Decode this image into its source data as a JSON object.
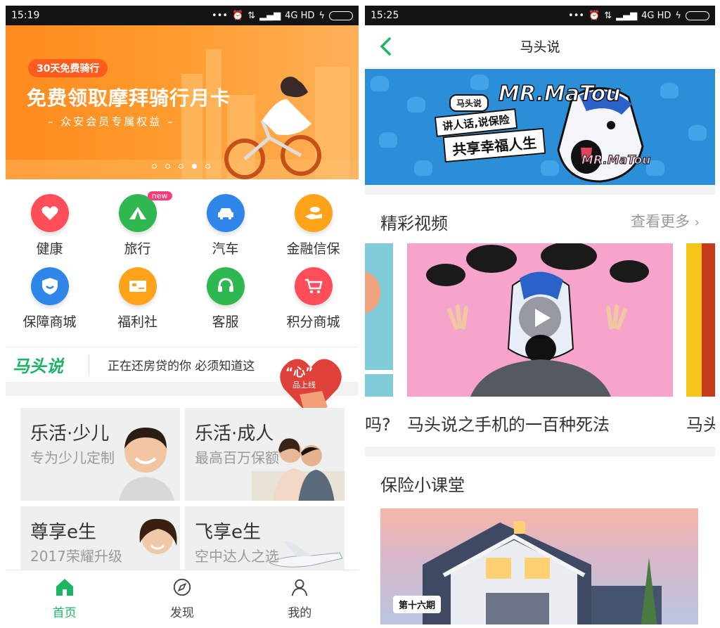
{
  "left": {
    "status": {
      "time": "15:19",
      "network": "4G HD"
    },
    "banner": {
      "badge": "30天免费骑行",
      "title": "免费领取摩拜骑行月卡",
      "subtitle": "– 众安会员专属权益 –",
      "dots_count": 5,
      "active_dot": 4
    },
    "grid": [
      {
        "label": "健康",
        "icon": "heart-icon",
        "color": "#ff4d5a"
      },
      {
        "label": "旅行",
        "icon": "tent-icon",
        "color": "#2fb84f",
        "badge": "new"
      },
      {
        "label": "汽车",
        "icon": "car-icon",
        "color": "#2e86e8"
      },
      {
        "label": "金融信保",
        "icon": "hand-coin-icon",
        "color": "#ffa31a"
      },
      {
        "label": "保障商城",
        "icon": "shield-icon",
        "color": "#2e86e8"
      },
      {
        "label": "福利社",
        "icon": "ticket-icon",
        "color": "#ffa31a"
      },
      {
        "label": "客服",
        "icon": "headset-icon",
        "color": "#2fb84f"
      },
      {
        "label": "积分商城",
        "icon": "cart-icon",
        "color": "#ff4d5a"
      }
    ],
    "news": {
      "brand": "马头说",
      "headline": "正在还房贷的你 必须知道这",
      "heart_label": "“心”",
      "heart_sub": "品上线"
    },
    "cards": [
      {
        "title": "乐活·少儿",
        "subtitle": "专为少儿定制"
      },
      {
        "title": "乐活·成人",
        "subtitle": "最高百万保额"
      },
      {
        "title": "尊享e生",
        "subtitle": "2017荣耀升级"
      },
      {
        "title": "飞享e生",
        "subtitle": "空中达人之选"
      }
    ],
    "tabs": [
      {
        "label": "首页",
        "icon": "home-icon",
        "active": true
      },
      {
        "label": "发现",
        "icon": "compass-icon",
        "active": false
      },
      {
        "label": "我的",
        "icon": "user-icon",
        "active": false
      }
    ]
  },
  "right": {
    "status": {
      "time": "15:25",
      "network": "4G HD"
    },
    "nav": {
      "title": "马头说"
    },
    "banner": {
      "tag": "马头说",
      "line1": "讲人话,说保险",
      "line2": "共享幸福人生",
      "logo": "MR.MaTou",
      "logo_small": "MR.MaTou"
    },
    "videos": {
      "title": "精彩视频",
      "more": "查看更多",
      "prev_caption": "吗?",
      "main_caption": "马头说之手机的一百种死法",
      "next_caption": "马头"
    },
    "classroom": {
      "title": "保险小课堂",
      "episode": "第十六期"
    }
  },
  "colors": {
    "green": "#1db464",
    "orange": "#ff8a1f",
    "blue": "#2a8fd8"
  }
}
